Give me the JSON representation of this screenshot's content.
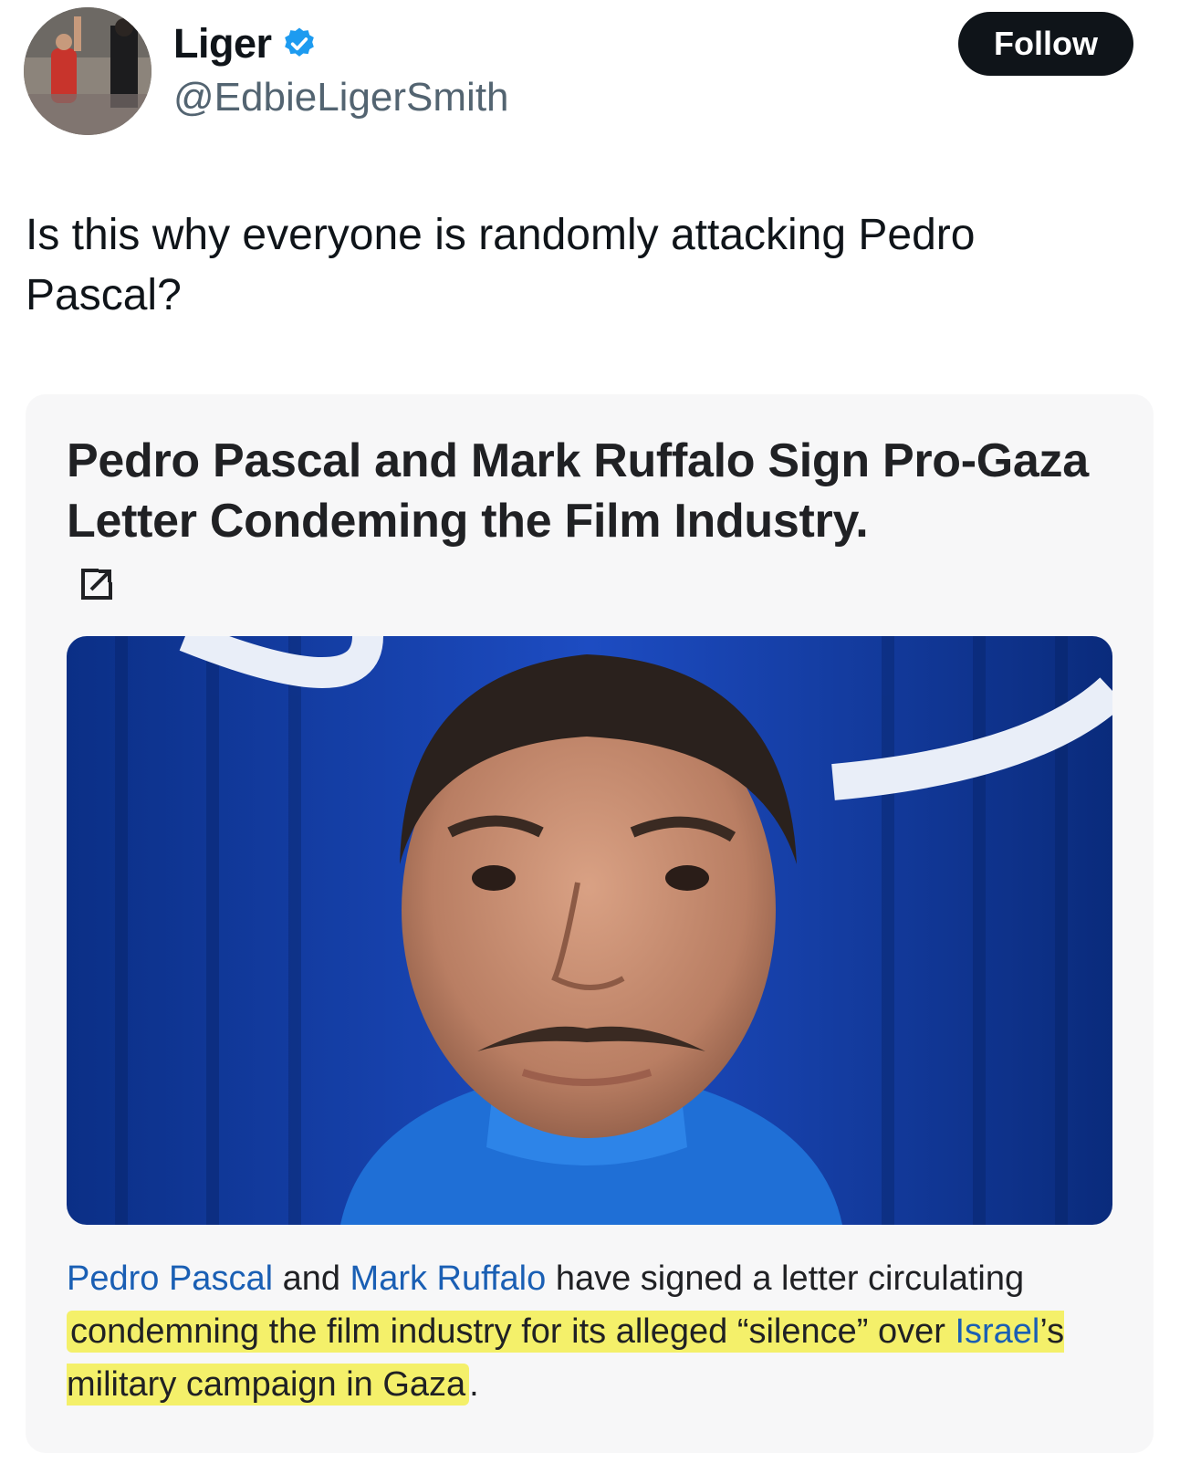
{
  "profile": {
    "display_name": "Liger",
    "handle": "@EdbieLigerSmith",
    "follow_label": "Follow"
  },
  "tweet": {
    "text": "Is this why everyone is randomly attacking Pedro Pascal?"
  },
  "card": {
    "title": "Pedro Pascal and Mark Ruffalo Sign Pro-Gaza Letter Condeming the Film Industry.",
    "body": {
      "link1": "Pedro Pascal",
      "t1": " and ",
      "link2": "Mark Ruffalo",
      "t2": " have signed a letter circulating ",
      "hl1": "condemning the film industry for its alleged “silence” over ",
      "hl_link": "Israel",
      "hl2": "’s military campaign in Gaza",
      "end": "."
    }
  },
  "colors": {
    "follow_bg": "#0f1419",
    "verified": "#1d9bf0",
    "link": "#1a5fb4",
    "highlight": "#f4f06a"
  },
  "icons": {
    "verified": "verified-badge-icon",
    "external_link": "external-link-icon"
  }
}
